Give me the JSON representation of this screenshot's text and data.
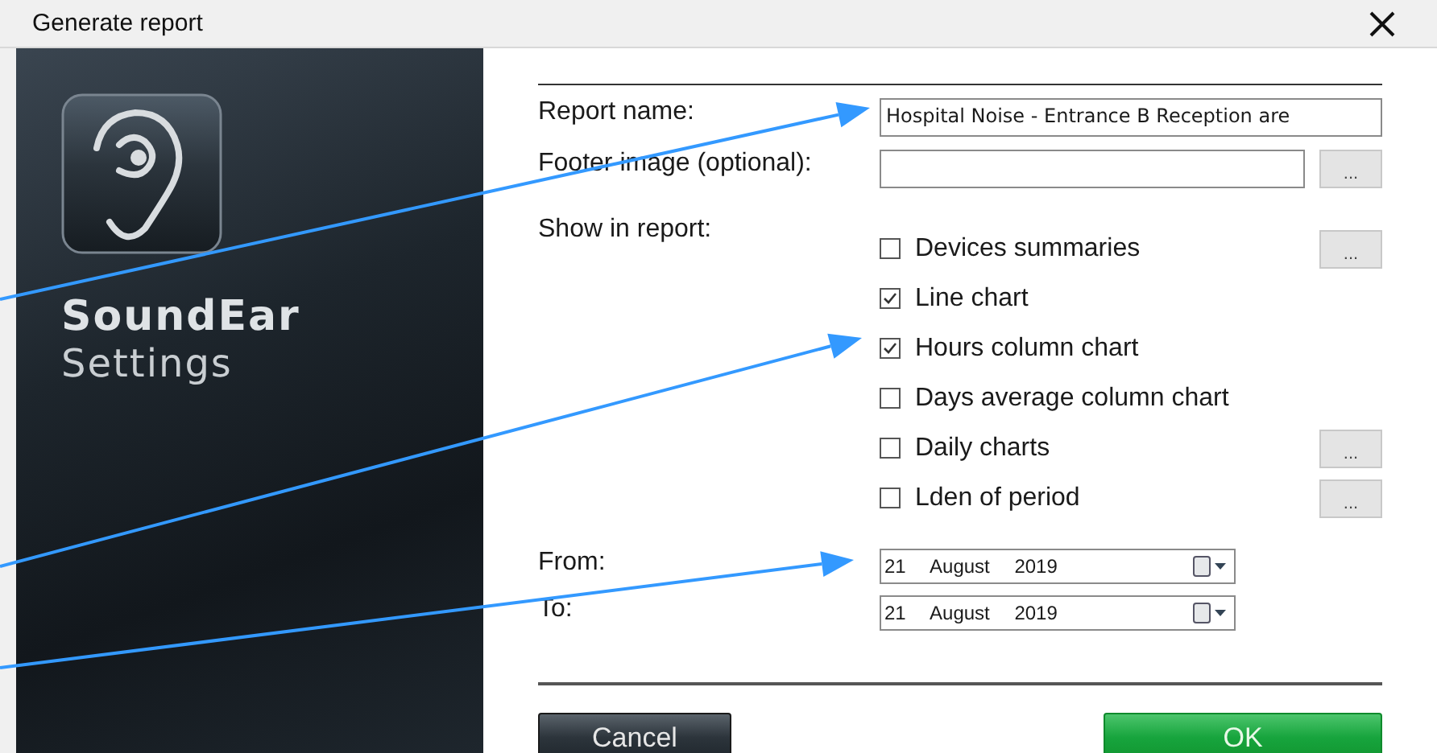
{
  "window": {
    "title": "Generate report"
  },
  "branding": {
    "name": "SoundEar",
    "subtitle": "Settings"
  },
  "form": {
    "report_name": {
      "label": "Report name:",
      "value": "Hospital Noise - Entrance B Reception are"
    },
    "footer_image": {
      "label": "Footer image (optional):",
      "button": "..."
    },
    "show_in_report": {
      "label": "Show in report:",
      "options": [
        {
          "label": "Devices summaries",
          "checked": false,
          "button": "..."
        },
        {
          "label": "Line chart",
          "checked": true
        },
        {
          "label": "Hours column chart",
          "checked": true
        },
        {
          "label": "Days average column chart",
          "checked": false
        },
        {
          "label": "Daily charts",
          "checked": false,
          "button": "..."
        },
        {
          "label": "Lden of period",
          "checked": false,
          "button": "..."
        }
      ]
    },
    "from": {
      "label": "From:",
      "value": "21 August 2019"
    },
    "to": {
      "label": "To:",
      "value": "21 August 2019"
    }
  },
  "buttons": [
    {
      "label": "Cancel",
      "kind": "secondary"
    },
    {
      "label": "OK",
      "kind": "primary"
    }
  ]
}
